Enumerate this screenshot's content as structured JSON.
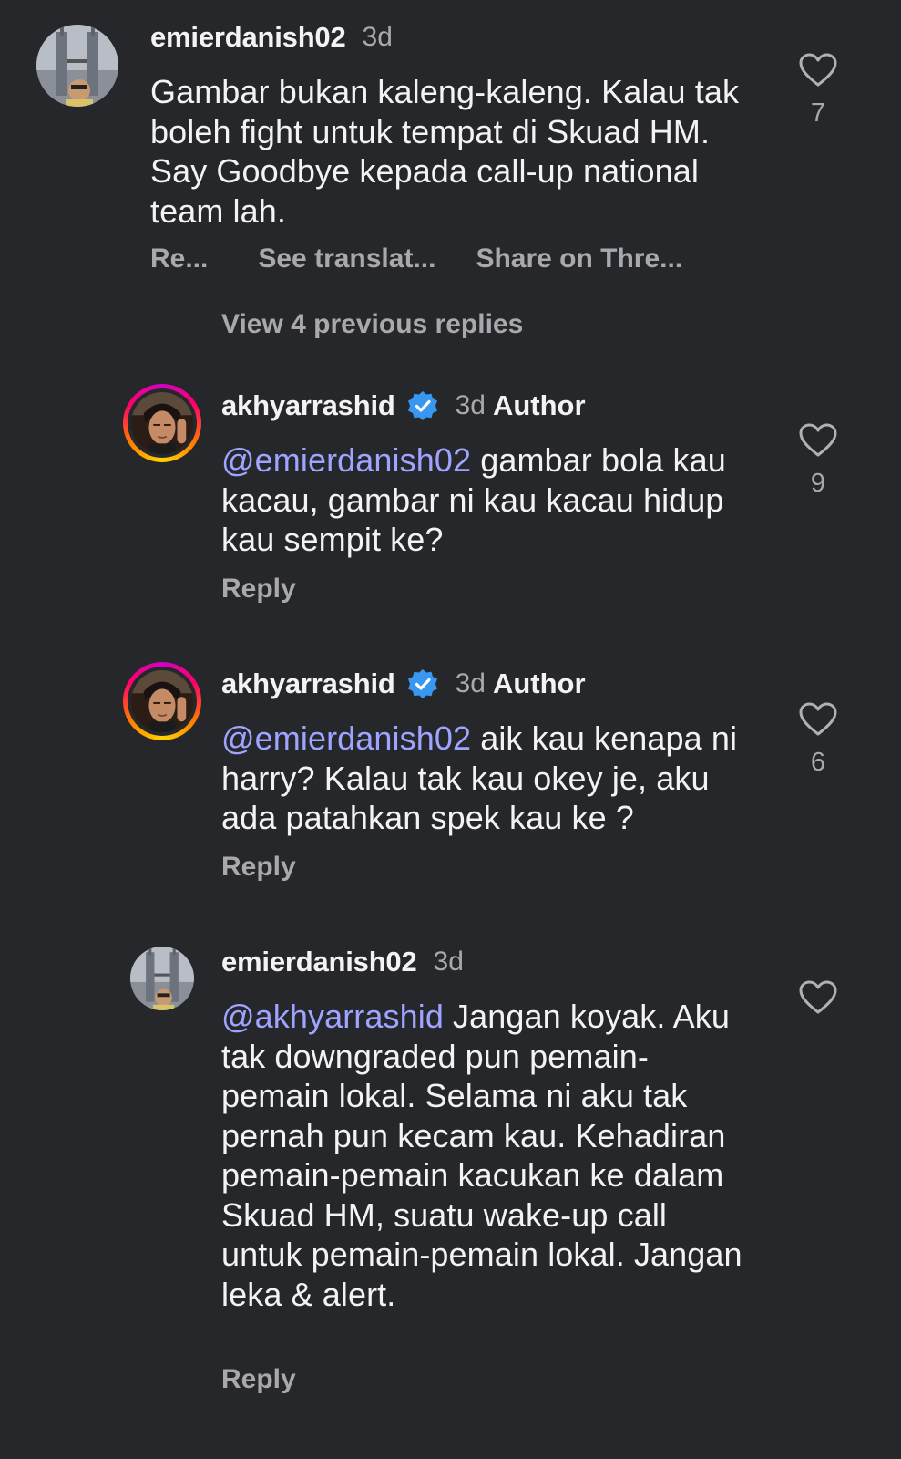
{
  "comments": [
    {
      "username": "emierdanish02",
      "time": "3d",
      "text": "Gambar bukan kaleng-kaleng. Kalau tak boleh fight untuk tempat di Skuad HM. Say Goodbye kepada call-up national team lah.",
      "like_count": "7",
      "actions": {
        "reply": "Re...",
        "translate": "See translat...",
        "share": "Share on Thre..."
      },
      "icons": {
        "like": "heart-outline-icon"
      }
    },
    {
      "username": "akhyarrashid",
      "time": "3d",
      "author_label": "Author",
      "mention": "@emierdanish02",
      "text": " gambar bola kau kacau, gambar ni kau kacau hidup kau sempit ke?",
      "like_count": "9",
      "reply": "Reply",
      "icons": {
        "verified": "verified-badge-icon",
        "like": "heart-outline-icon"
      }
    },
    {
      "username": "akhyarrashid",
      "time": "3d",
      "author_label": "Author",
      "mention": "@emierdanish02",
      "text": " aik kau kenapa ni harry? Kalau tak kau okey je, aku ada patahkan spek kau ke ?",
      "like_count": "6",
      "reply": "Reply",
      "icons": {
        "verified": "verified-badge-icon",
        "like": "heart-outline-icon"
      }
    },
    {
      "username": "emierdanish02",
      "time": "3d",
      "mention": "@akhyarrashid",
      "text": " Jangan koyak. Aku tak downgraded pun pemain-pemain lokal. Selama ni aku tak pernah pun kecam kau. Kehadiran pemain-pemain kacukan ke dalam Skuad HM, suatu wake-up call untuk pemain-pemain lokal. Jangan leka & alert.",
      "reply": "Reply",
      "icons": {
        "like": "heart-outline-icon"
      }
    }
  ],
  "view_replies": "View 4 previous replies",
  "colors": {
    "background": "#26272b",
    "mention": "#9ea4ff",
    "secondary_text": "#a8a8ad",
    "verified": "#3897f0"
  }
}
